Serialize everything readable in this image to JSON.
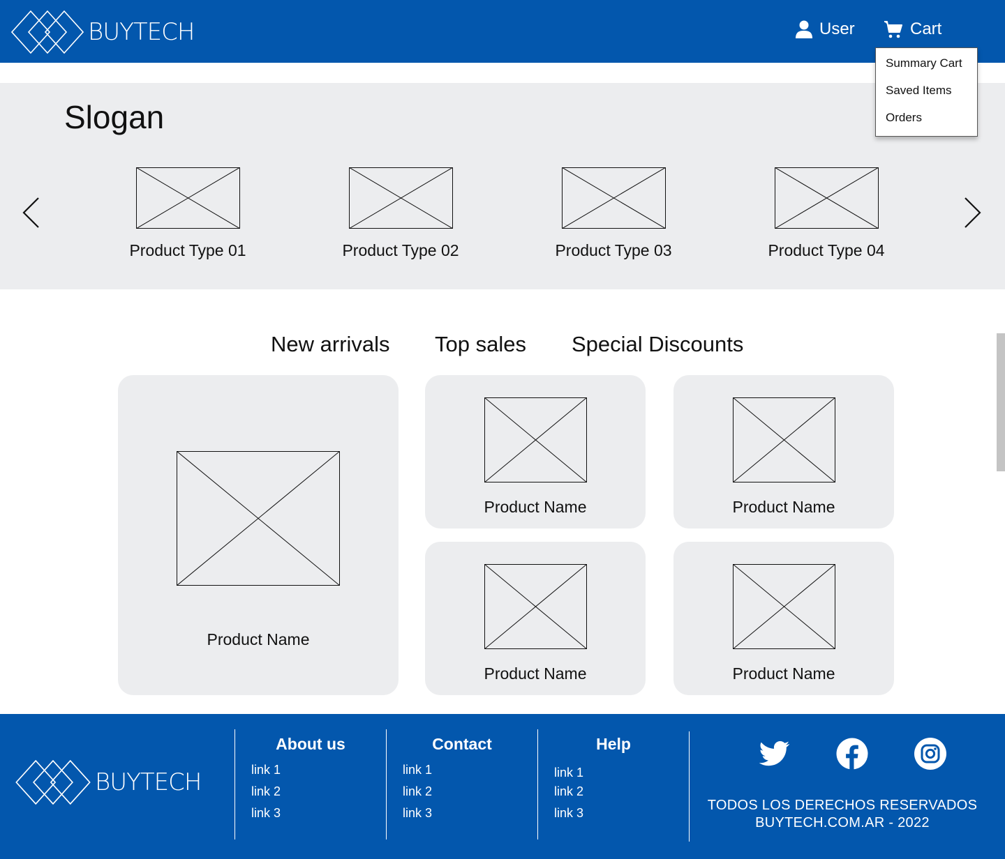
{
  "brand": {
    "name": "BUYTECH"
  },
  "colors": {
    "primary": "#0357ad",
    "panel": "#ecedef",
    "text": "#111111"
  },
  "header": {
    "user_label": "User",
    "cart_label": "Cart",
    "user_icon": "user-icon",
    "cart_icon": "cart-icon"
  },
  "cart_menu": {
    "items": [
      {
        "label": "Summary Cart"
      },
      {
        "label": "Saved Items"
      },
      {
        "label": "Orders"
      }
    ]
  },
  "hero": {
    "slogan": "Slogan",
    "product_types": [
      {
        "label": "Product Type 01"
      },
      {
        "label": "Product Type 02"
      },
      {
        "label": "Product Type 03"
      },
      {
        "label": "Product Type 04"
      }
    ]
  },
  "tabs": [
    {
      "label": "New arrivals"
    },
    {
      "label": "Top sales"
    },
    {
      "label": "Special Discounts"
    }
  ],
  "products": [
    {
      "name": "Product Name"
    },
    {
      "name": "Product Name"
    },
    {
      "name": "Product Name"
    },
    {
      "name": "Product Name"
    },
    {
      "name": "Product Name"
    }
  ],
  "footer": {
    "columns": [
      {
        "title": "About us",
        "links": [
          "link 1",
          "link 2",
          "link 3"
        ]
      },
      {
        "title": "Contact",
        "links": [
          "link 1",
          "link 2",
          "link 3"
        ]
      },
      {
        "title": "Help",
        "links": [
          "link 1",
          "link 2",
          "link 3"
        ]
      }
    ],
    "social": [
      "twitter-icon",
      "facebook-icon",
      "instagram-icon"
    ],
    "rights_line1": "TODOS LOS DERECHOS RESERVADOS",
    "rights_line2": "BUYTECH.COM.AR - 2022"
  }
}
